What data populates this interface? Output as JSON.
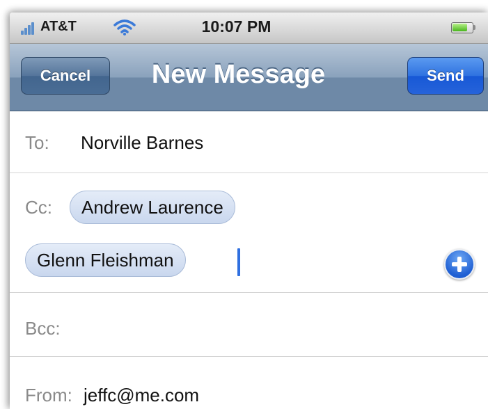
{
  "status_bar": {
    "carrier": "AT&T",
    "time": "10:07 PM",
    "icons": [
      "signal-bars-icon",
      "wifi-icon",
      "battery-icon"
    ],
    "battery_level": 0.8
  },
  "nav": {
    "cancel_label": "Cancel",
    "title": "New Message",
    "send_label": "Send"
  },
  "to": {
    "label": "To:",
    "value": "Norville Barnes"
  },
  "cc": {
    "label": "Cc:",
    "recipients": [
      "Andrew Laurence",
      "Glenn Fleishman"
    ],
    "add_icon": "add-contact-icon"
  },
  "bcc": {
    "label": "Bcc:"
  },
  "from": {
    "label": "From:",
    "value": "jeffc@me.com"
  },
  "colors": {
    "nav_bar": "#6e89a7",
    "send_button": "#1758d6",
    "chip": "#c9d7ee",
    "cursor": "#2f6fe0"
  }
}
